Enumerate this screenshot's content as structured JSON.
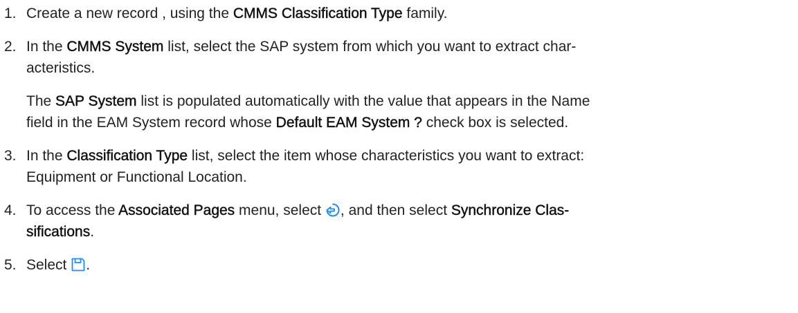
{
  "steps": [
    {
      "number": "1.",
      "parts": [
        "Create a new record , using the ",
        "CMMS Classification Type",
        " family."
      ]
    },
    {
      "number": "2.",
      "parts": [
        "In the ",
        "CMMS System",
        " list, select the SAP system from which you want to extract char-",
        "acteristics."
      ],
      "note": [
        "The ",
        "SAP System",
        " list is populated automatically with the value that appears in the Name",
        "field in the EAM System record whose ",
        "Default EAM System ?",
        " check box is selected."
      ]
    },
    {
      "number": "3.",
      "parts": [
        "In the ",
        "Classification Type",
        " list, select the item whose characteristics you want to extract:",
        "Equipment or Functional Location."
      ]
    },
    {
      "number": "4.",
      "parts": [
        "To access the ",
        "Associated Pages",
        " menu, select ",
        ", and then select ",
        "Synchronize Clas-",
        "sifications",
        "."
      ],
      "icon": "associated-pages-icon"
    },
    {
      "number": "5.",
      "parts": [
        "Select ",
        "."
      ],
      "icon": "save-icon"
    }
  ],
  "colors": {
    "icon_blue": "#1a8cff",
    "text": "#222222"
  }
}
